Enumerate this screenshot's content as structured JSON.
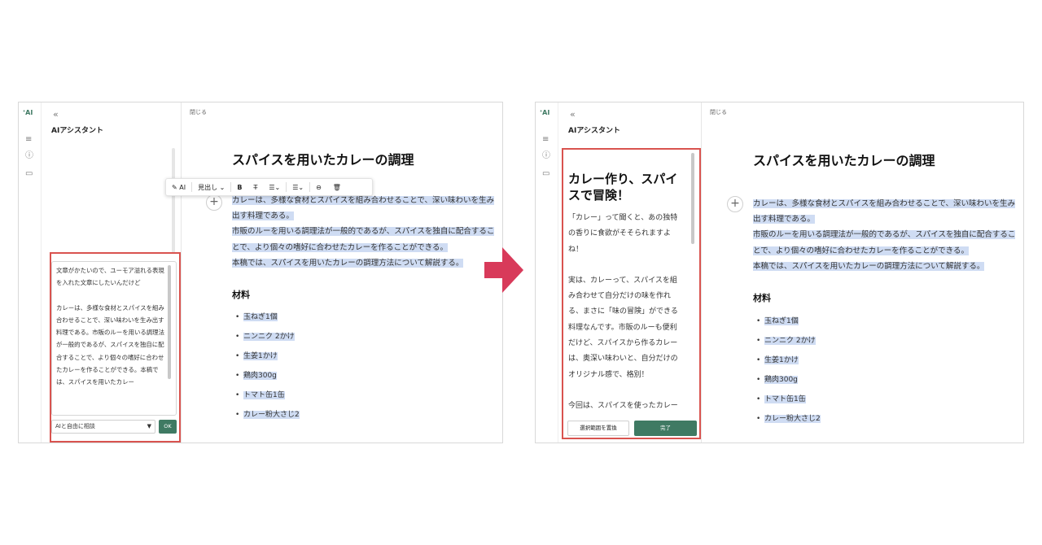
{
  "colors": {
    "accent": "#3f7a63",
    "highlight": "#cfdcf3",
    "outline": "#d9534f",
    "arrow": "#d83a5a"
  },
  "common": {
    "rail_ai": "ᐩAI",
    "collapse": "«",
    "panel_title": "AIアシスタント",
    "close_label": "閉じる"
  },
  "document": {
    "title": "スパイスを用いたカレーの調理",
    "paragraphs": [
      "カレーは、多様な食材とスパイスを組み合わせることで、深い味わいを生み出す料理である。",
      "市販のルーを用いる調理法が一般的であるが、スパイスを独自に配合することで、より個々の嗜好に合わせたカレーを作ることができる。",
      "本稿では、スパイスを用いたカレーの調理方法について解説する。"
    ],
    "section_heading": "材料",
    "ingredients": [
      "玉ねぎ1個",
      "ニンニク 2かけ",
      "生姜1かけ",
      "鶏肉300g",
      "トマト缶1缶",
      "カレー粉大さじ2"
    ]
  },
  "toolbar": {
    "ai_label": "AI",
    "heading_label": "見出し",
    "bold_label": "B",
    "strike_label": "T̶",
    "list_label": "☰",
    "align_label": "☰",
    "link_label": "⊖",
    "delete_label": "🗑"
  },
  "left_panel": {
    "prompt": "文章がかたいので、ユーモア溢れる表現を入れた文章にしたいんだけど",
    "quoted": "カレーは、多様な食材とスパイスを組み合わせることで、深い味わいを生み出す料理である。市販のルーを用いる調理法が一般的であるが、スパイスを独自に配合することで、より個々の嗜好に合わせたカレーを作ることができる。本稿では、スパイスを用いたカレー",
    "mode_select": "AIと自由に相談",
    "ok_label": "OK"
  },
  "right_panel": {
    "generated_title": "カレー作り、スパイスで冒険！",
    "generated_para1": "「カレー」って聞くと、あの独特の香りに食欲がそそられますよね！",
    "generated_para2": "実は、カレーって、スパイスを組み合わせて自分だけの味を作れる、まさに「味の冒険」ができる料理なんです。市販のルーも便利だけど、スパイスから作るカレーは、奥深い味わいと、自分だけのオリジナル感で、格別！",
    "generated_para3": "今回は、スパイスを使ったカレー",
    "replace_label": "選択範囲を置換",
    "done_label": "完了"
  }
}
